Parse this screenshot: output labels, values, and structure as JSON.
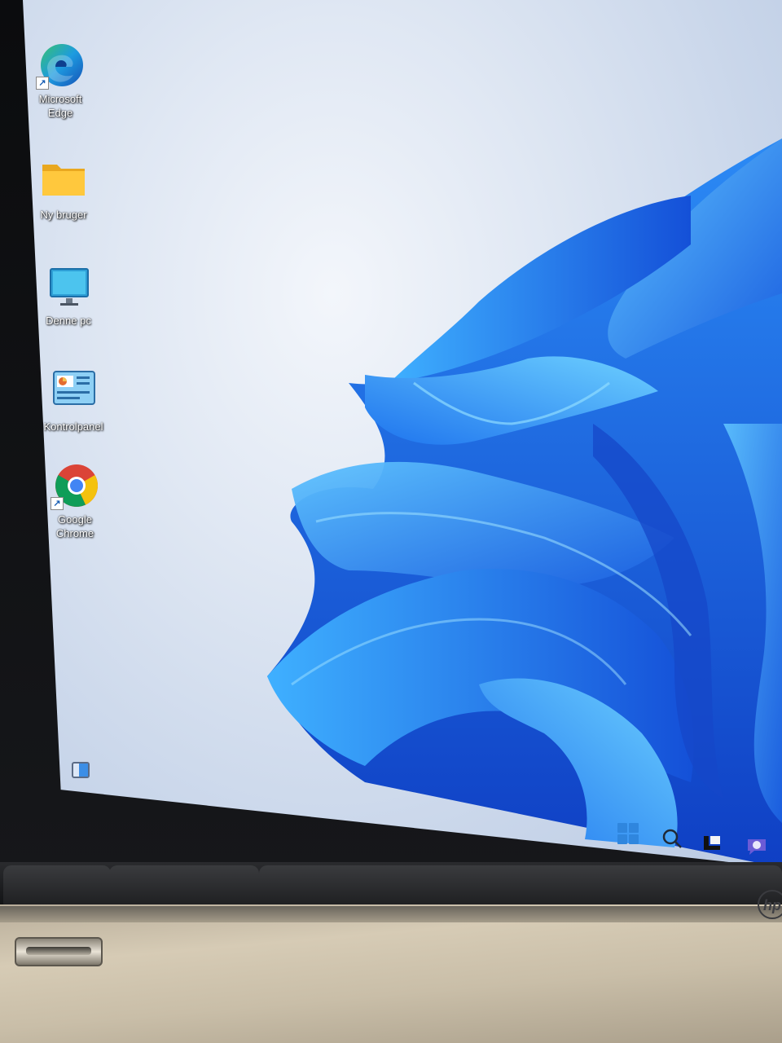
{
  "desktop": {
    "icons": [
      {
        "label": "Microsoft Edge",
        "icon": "edge-icon",
        "shortcut": true
      },
      {
        "label": "Ny bruger",
        "icon": "folder-icon",
        "shortcut": false
      },
      {
        "label": "Denne pc",
        "icon": "monitor-icon",
        "shortcut": false
      },
      {
        "label": "Kontrolpanel",
        "icon": "control-panel-icon",
        "shortcut": false
      },
      {
        "label": "Google Chrome",
        "icon": "chrome-icon",
        "shortcut": true
      }
    ]
  },
  "taskbar": {
    "items": [
      "widgets-icon",
      "start-icon",
      "search-icon",
      "task-view-icon",
      "chat-icon"
    ]
  },
  "chassis": {
    "brand_logo": "hp"
  },
  "colors": {
    "accent": "#2f86de",
    "wallpaper_blue": "#1f6fe6",
    "wallpaper_light": "#dfe7f3"
  }
}
